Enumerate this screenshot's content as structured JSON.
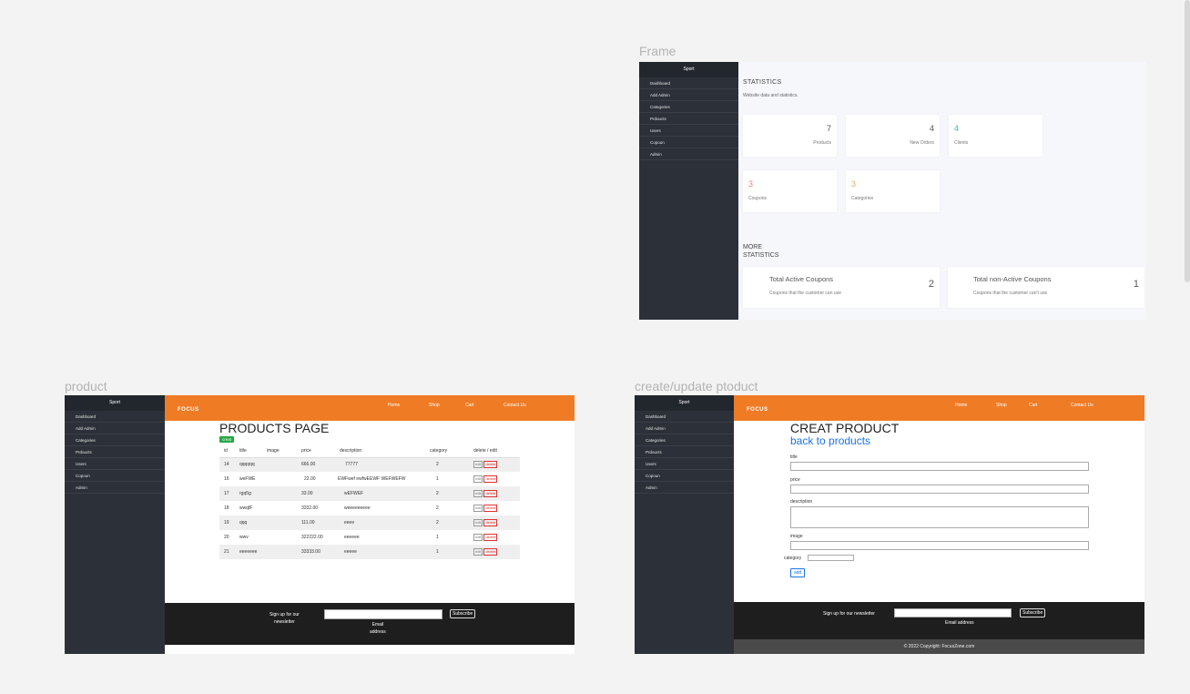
{
  "labels": {
    "frame1": "Frame",
    "frame2": "product",
    "frame3": "create/update ptoduct"
  },
  "sidebar": {
    "title": "Sport",
    "items": [
      "Dashboard",
      "Add Admin",
      "Categories",
      "Prdoucts",
      "Users",
      "Copoun",
      "Admin"
    ]
  },
  "stats": {
    "heading": "STATISTICS",
    "subheading": "Website data and statistics.",
    "products": {
      "value": "7",
      "label": "Products"
    },
    "orders": {
      "value": "4",
      "label": "New Orders"
    },
    "clients": {
      "value": "4",
      "label": "Clients"
    },
    "coupons": {
      "value": "3",
      "label": "Coupons"
    },
    "categories": {
      "value": "3",
      "label": "Categories"
    },
    "more_line1": "MORE",
    "more_line2": "STATISTICS",
    "active": {
      "title": "Total Active Coupons",
      "desc": "Coupons that the customer can use",
      "value": "2"
    },
    "inactive": {
      "title": "Total non-Active Coupons",
      "desc": "Coupons that the customer can't use",
      "value": "1"
    },
    "colors": {
      "clients": "#2ec4a5",
      "coupons": "#f27a7a",
      "categories": "#f5a25d"
    }
  },
  "topnav": {
    "logo": "FOCUS",
    "home": "Home",
    "shop": "Shop",
    "cart": "Cart",
    "contact": "Contact Us",
    "color": "#f07b25"
  },
  "products": {
    "heading": "PRODUCTS PAGE",
    "create_label": "creat",
    "headers": [
      "id",
      "title",
      "image",
      "price",
      "description",
      "category",
      "delete / edit"
    ],
    "rows": [
      {
        "id": "14",
        "title": "qqqqqq",
        "price": "666.00",
        "description": "77777",
        "category": "2"
      },
      {
        "id": "16",
        "title": "weFWE",
        "price": "22.00",
        "description": "EWFwef ewfwEEWF WEFWEFW",
        "category": "1"
      },
      {
        "id": "17",
        "title": "rgq5g",
        "price": "33.00",
        "description": "wEFWEF",
        "category": "2"
      },
      {
        "id": "18",
        "title": "wwqfF",
        "price": "3332.00",
        "description": "weeeeeeeee",
        "category": "2"
      },
      {
        "id": "19",
        "title": "qqq",
        "price": "111.00",
        "description": "eeee",
        "category": "2"
      },
      {
        "id": "20",
        "title": "wwv",
        "price": "322222.00",
        "description": "eeeeee",
        "category": "1"
      },
      {
        "id": "21",
        "title": "eeeeeee",
        "price": "33333.00",
        "description": "eeeee",
        "category": "1"
      }
    ],
    "edit_label": "edit",
    "delete_label": "delete"
  },
  "footer": {
    "signup_line1": "Sign up for our",
    "signup_line2": "newsletter",
    "signup_full": "Sign up for our newsletter",
    "email_line1": "Email",
    "email_line2": "address",
    "email_full": "Email address",
    "subscribe": "Subscribe",
    "copyright": "© 2022 Copyright:  FocusZone.com"
  },
  "create": {
    "heading": "CREAT PRODUCT",
    "back": "back to products",
    "title_label": "title",
    "price_label": "price",
    "description_label": "description",
    "image_label": "image",
    "category_label": "category",
    "add": "add"
  }
}
